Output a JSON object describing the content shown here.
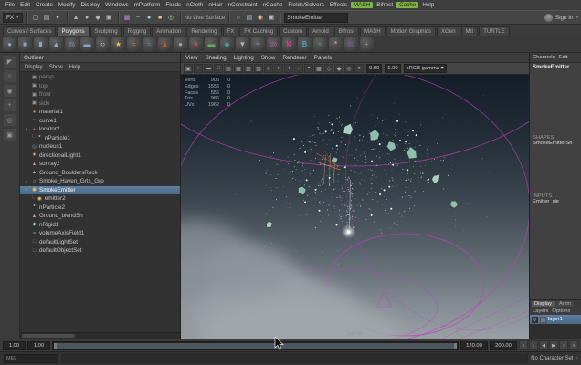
{
  "menu_bar": {
    "items": [
      {
        "label": "File"
      },
      {
        "label": "Edit"
      },
      {
        "label": "Create"
      },
      {
        "label": "Modify"
      },
      {
        "label": "Display"
      },
      {
        "label": "Windows"
      },
      {
        "label": "mPlatform"
      },
      {
        "label": "Fluids"
      },
      {
        "label": "nCloth"
      },
      {
        "label": "nHair"
      },
      {
        "label": "nConstraint"
      },
      {
        "label": "nCache"
      },
      {
        "label": "Fields/Solvers"
      },
      {
        "label": "Effects"
      },
      {
        "label": "MASH",
        "highlight": true
      },
      {
        "label": "Bifrost"
      },
      {
        "label": "Cache",
        "highlight": true
      },
      {
        "label": "Help"
      }
    ]
  },
  "status_line": {
    "menuset": "FX",
    "no_live_surface": "No Live Surface",
    "selection_field": "SmokeEmitter",
    "sign_in": "Sign In",
    "file_icons": [
      {
        "name": "new-scene-icon",
        "glyph": "▢",
        "color": "#c4c4c4"
      },
      {
        "name": "open-scene-icon",
        "glyph": "▤",
        "color": "#c4c4c4"
      },
      {
        "name": "save-scene-icon",
        "glyph": "▼",
        "color": "#c4c4c4"
      }
    ],
    "selection_icons": [
      {
        "name": "select-hierarchy-icon",
        "glyph": "▲",
        "color": "#b5b5b5"
      },
      {
        "name": "select-object-icon",
        "glyph": "●",
        "color": "#b5b5b5"
      },
      {
        "name": "select-component-icon",
        "glyph": "◆",
        "color": "#b5b5b5"
      },
      {
        "name": "selection-mask-icon",
        "glyph": "▣",
        "color": "#b5b5b5"
      }
    ],
    "snap_icons": [
      {
        "name": "snap-grid-icon",
        "glyph": "▦",
        "color": "#b48ce0"
      },
      {
        "name": "snap-curve-icon",
        "glyph": "~",
        "color": "#8fd3c0"
      },
      {
        "name": "snap-point-icon",
        "glyph": "●",
        "color": "#9ad1e8"
      },
      {
        "name": "snap-plane-icon",
        "glyph": "■",
        "color": "#e8c08a"
      },
      {
        "name": "make-live-icon",
        "glyph": "◎",
        "color": "#8fc98f"
      }
    ],
    "render_icons": [
      {
        "name": "construction-history-icon",
        "glyph": "○",
        "color": "#c0c0c0"
      },
      {
        "name": "render-view-icon",
        "glyph": "▤",
        "color": "#9ec7e8"
      },
      {
        "name": "ipr-render-icon",
        "glyph": "◉",
        "color": "#e8b78a"
      },
      {
        "name": "render-settings-icon",
        "glyph": "▣",
        "color": "#c0c0c0"
      }
    ]
  },
  "shelf": {
    "tabs": [
      "Curves / Surfaces",
      "Polygons",
      "Sculpting",
      "Rigging",
      "Animation",
      "Rendering",
      "FX",
      "FX Caching",
      "Custom",
      "Arnold",
      "Bifrost",
      "MASH",
      "Motion Graphics",
      "XGen",
      "MtI",
      "TURTLE"
    ],
    "active_tab": "Polygons",
    "icons": [
      {
        "name": "poly-sphere-icon",
        "glyph": "●",
        "color": "#86a8d0"
      },
      {
        "name": "poly-cube-icon",
        "glyph": "■",
        "color": "#86a8d0"
      },
      {
        "name": "poly-cylinder-icon",
        "glyph": "▮",
        "color": "#86a8d0"
      },
      {
        "name": "poly-cone-icon",
        "glyph": "▲",
        "color": "#86a8d0"
      },
      {
        "name": "poly-torus-icon",
        "glyph": "◎",
        "color": "#86a8d0"
      },
      {
        "name": "poly-plane-icon",
        "glyph": "▬",
        "color": "#86a8d0"
      },
      {
        "name": "nparticle-icon",
        "glyph": "○",
        "color": "#e8e8e8"
      },
      {
        "name": "emitter-icon",
        "glyph": "★",
        "color": "#f0c040"
      },
      {
        "name": "fluid-icon",
        "glyph": "≈",
        "color": "#e08030"
      },
      {
        "name": "ocean-icon",
        "glyph": "≈",
        "color": "#4090d0"
      },
      {
        "name": "fire-icon",
        "glyph": "▲",
        "color": "#e05020"
      },
      {
        "name": "smoke-icon",
        "glyph": "●",
        "color": "#a0a0a0"
      },
      {
        "name": "explosion-icon",
        "glyph": "★",
        "color": "#e04040"
      },
      {
        "name": "ncloth-icon",
        "glyph": "▬",
        "color": "#60b060"
      },
      {
        "name": "nrigid-icon",
        "glyph": "◆",
        "color": "#40a0a0"
      },
      {
        "name": "gravity-icon",
        "glyph": "▼",
        "color": "#b0b0b0"
      },
      {
        "name": "wind-icon",
        "glyph": "~",
        "color": "#c0c0c0"
      },
      {
        "name": "volume-field-icon",
        "glyph": "◎",
        "color": "#c060c0"
      },
      {
        "name": "mash-icon",
        "glyph": "M",
        "color": "#e040a0"
      },
      {
        "name": "bifrost-icon",
        "glyph": "B",
        "color": "#40c0e0"
      },
      {
        "name": "boss-icon",
        "glyph": "≈",
        "color": "#30b0a0"
      },
      {
        "name": "turbulence-icon",
        "glyph": "*",
        "color": "#d0d040"
      },
      {
        "name": "vortex-icon",
        "glyph": "◎",
        "color": "#9060d0"
      },
      {
        "name": "drag-icon",
        "glyph": "+",
        "color": "#909090"
      }
    ]
  },
  "toolbox_icons": [
    {
      "name": "select-tool-icon",
      "glyph": "◤"
    },
    {
      "name": "lasso-tool-icon",
      "glyph": "○"
    },
    {
      "name": "paint-select-tool-icon",
      "glyph": "◉"
    },
    {
      "name": "move-tool-icon",
      "glyph": "+"
    },
    {
      "name": "rotate-tool-icon",
      "glyph": "◎"
    },
    {
      "name": "scale-tool-icon",
      "glyph": "▣"
    }
  ],
  "outliner": {
    "title": "Outliner",
    "menus": [
      "Display",
      "Show",
      "Help"
    ],
    "icon_defs": {
      "camera": {
        "glyph": "▣",
        "color": "#9a9a9a"
      },
      "material": {
        "glyph": "●",
        "color": "#c8915a"
      },
      "curve": {
        "glyph": "~",
        "color": "#99bbdd"
      },
      "locator": {
        "glyph": "+",
        "color": "#e66666"
      },
      "particle": {
        "glyph": "*",
        "color": "#e8e8e8"
      },
      "nucleus": {
        "glyph": "◎",
        "color": "#66aacc"
      },
      "light": {
        "glyph": "☀",
        "color": "#ffe27a"
      },
      "mesh": {
        "glyph": "▲",
        "color": "#bb99aa"
      },
      "group": {
        "glyph": "○",
        "color": "#cccc99"
      },
      "emitter": {
        "glyph": "◉",
        "color": "#f7c75a"
      },
      "nrigid": {
        "glyph": "◆",
        "color": "#88cccc"
      },
      "field": {
        "glyph": "≈",
        "color": "#d39ad3"
      },
      "set": {
        "glyph": "□",
        "color": "#999999"
      }
    },
    "items": [
      {
        "label": "persp",
        "icon": "camera",
        "dim": true
      },
      {
        "label": "top",
        "icon": "camera",
        "dim": true
      },
      {
        "label": "front",
        "icon": "camera",
        "dim": true
      },
      {
        "label": "side",
        "icon": "camera",
        "dim": true
      },
      {
        "label": "material1",
        "icon": "material"
      },
      {
        "label": "curve1",
        "icon": "curve"
      },
      {
        "label": "locator2",
        "icon": "locator",
        "expander": "▾"
      },
      {
        "label": "nParticle1",
        "icon": "particle",
        "child": true
      },
      {
        "label": "nucleus1",
        "icon": "nucleus"
      },
      {
        "label": "directionalLight1",
        "icon": "light"
      },
      {
        "label": "sunray2",
        "icon": "mesh"
      },
      {
        "label": "Ground_BouldersRock",
        "icon": "mesh"
      },
      {
        "label": "Smoke_Haven_Grts_Grp",
        "icon": "group",
        "expander": "▸"
      },
      {
        "label": "SmokeEmitter",
        "icon": "emitter",
        "selected": true,
        "expander": "▾"
      },
      {
        "label": "emitter2",
        "icon": "emitter",
        "child": true
      },
      {
        "label": "nParticle2",
        "icon": "particle"
      },
      {
        "label": "Ground_blendSh",
        "icon": "mesh"
      },
      {
        "label": "nRigid1",
        "icon": "nrigid"
      },
      {
        "label": "volumeAxisField1",
        "icon": "field"
      },
      {
        "label": "defaultLightSet",
        "icon": "set"
      },
      {
        "label": "defaultObjectSet",
        "icon": "set"
      }
    ]
  },
  "viewport": {
    "menus": [
      "View",
      "Shading",
      "Lighting",
      "Show",
      "Renderer",
      "Panels"
    ],
    "toolbar_icons": [
      {
        "name": "select-camera-icon",
        "glyph": "▣"
      },
      {
        "name": "lock-camera-icon",
        "glyph": "▪"
      },
      {
        "name": "camera-attributes-icon",
        "glyph": "▬"
      },
      {
        "name": "film-gate-icon",
        "glyph": "□"
      },
      {
        "name": "resolution-gate-icon",
        "glyph": "▤"
      },
      {
        "name": "gate-mask-icon",
        "glyph": "▦"
      },
      {
        "name": "safe-action-icon",
        "glyph": "▧"
      },
      {
        "name": "safe-title-icon",
        "glyph": "▨"
      },
      {
        "name": "fill-light-icon",
        "glyph": "☀"
      },
      {
        "name": "ambient-light-icon",
        "glyph": "◐"
      },
      {
        "name": "shadows-icon",
        "glyph": "◑"
      },
      {
        "name": "ssao-icon",
        "glyph": "◒"
      },
      {
        "name": "motion-blur-icon",
        "glyph": "◓"
      },
      {
        "name": "multisample-icon",
        "glyph": "▩"
      },
      {
        "name": "isolate-select-icon",
        "glyph": "◇"
      },
      {
        "name": "xray-icon",
        "glyph": "◆"
      },
      {
        "name": "wireframe-shaded-icon",
        "glyph": "◎"
      },
      {
        "name": "textured-icon",
        "glyph": "●"
      }
    ],
    "exposure": "0.00",
    "gamma": "1.00",
    "view_transform": "sRGB gamma",
    "camera_label": "persp",
    "hud": [
      {
        "label": "Verts",
        "v1": "906",
        "v2": "0"
      },
      {
        "label": "Edges",
        "v1": "1556",
        "v2": "0"
      },
      {
        "label": "Faces",
        "v1": "556",
        "v2": "0"
      },
      {
        "label": "Tris",
        "v1": "986",
        "v2": "0"
      },
      {
        "label": "UVs",
        "v1": "1962",
        "v2": "0"
      }
    ]
  },
  "channel_box": {
    "menus": [
      "Channels",
      "Edit"
    ],
    "object_name": "SmokeEmitter",
    "sections": [
      {
        "label": "SHAPES",
        "item": "SmokeEmitterSh"
      },
      {
        "label": "INPUTS",
        "item": "Emitter_sle"
      }
    ]
  },
  "layer_editor": {
    "tabs": [
      "Display",
      "Anim"
    ],
    "menus": [
      "Layers",
      "Options"
    ],
    "layers": [
      {
        "visible": "V",
        "name": "layer1",
        "selected": true
      }
    ]
  },
  "timeline": {
    "range_start": "1.00",
    "current_start": "1.00",
    "range_end": "120.00",
    "scene_end": "200.00",
    "playback_icons": [
      {
        "name": "go-to-start-icon",
        "glyph": "«"
      },
      {
        "name": "step-back-icon",
        "glyph": "‹"
      },
      {
        "name": "play-backwards-icon",
        "glyph": "◀"
      },
      {
        "name": "play-forward-icon",
        "glyph": "▶"
      },
      {
        "name": "step-forward-icon",
        "glyph": "›"
      },
      {
        "name": "go-to-end-icon",
        "glyph": "»"
      }
    ]
  },
  "command_line": {
    "label": "MEL"
  },
  "status_bar": {
    "character_set": "No Character Set"
  },
  "colors": {
    "selection_blue": "#5285a6",
    "menu_green": "#7fb346",
    "manipulator_magenta": "#c040c0",
    "chunk_teal": "#8fbfae"
  }
}
